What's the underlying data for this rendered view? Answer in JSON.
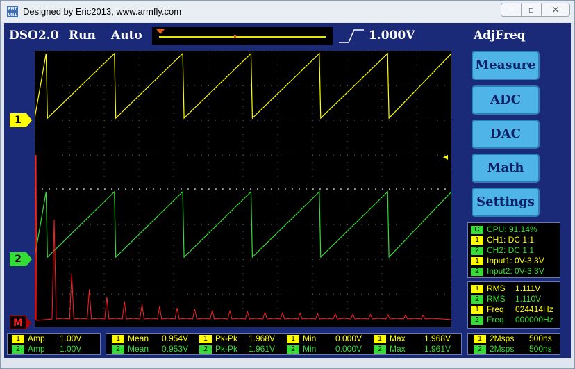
{
  "window": {
    "title": "Designed by Eric2013, www.armfly.com",
    "icon_text": "EMI UNI"
  },
  "header": {
    "product": "DSO2.0",
    "run_state": "Run",
    "mode": "Auto",
    "trigger_level": "1.000V",
    "adj": "AdjFreq"
  },
  "channels": {
    "ch1": "1",
    "ch2": "2",
    "math": "M"
  },
  "side_buttons": [
    "Measure",
    "ADC",
    "DAC",
    "Math",
    "Settings"
  ],
  "status_panel": [
    {
      "tag": "C",
      "text": "CPU: 91.14%",
      "color": "g"
    },
    {
      "tag": "1",
      "text": "CH1: DC 1:1",
      "color": "y"
    },
    {
      "tag": "2",
      "text": "CH2: DC 1:1",
      "color": "g"
    },
    {
      "tag": "1",
      "text": "Input1: 0V-3.3V",
      "color": "y"
    },
    {
      "tag": "2",
      "text": "Input2: 0V-3.3V",
      "color": "g"
    }
  ],
  "rms_panel": [
    {
      "tag": "1",
      "label": "RMS",
      "value": "1.111V",
      "color": "y"
    },
    {
      "tag": "2",
      "label": "RMS",
      "value": "1.110V",
      "color": "g"
    },
    {
      "tag": "1",
      "label": "Freq",
      "value": "024414Hz",
      "color": "y"
    },
    {
      "tag": "2",
      "label": "Freq",
      "value": "000000Hz",
      "color": "g"
    }
  ],
  "amp": [
    {
      "tag": "1",
      "label": "Amp",
      "value": "1.00V"
    },
    {
      "tag": "2",
      "label": "Amp",
      "value": "1.00V"
    }
  ],
  "measurements": {
    "ch1": {
      "mean": "0.954V",
      "pkpk": "1.968V",
      "min": "0.000V",
      "max": "1.968V"
    },
    "ch2": {
      "mean": "0.953V",
      "pkpk": "1.961V",
      "min": "0.000V",
      "max": "1.961V"
    },
    "labels": {
      "mean": "Mean",
      "pkpk": "Pk-Pk",
      "min": "Min",
      "max": "Max"
    }
  },
  "timebase": [
    {
      "tag": "1",
      "rate": "2Msps",
      "div": "500ns"
    },
    {
      "tag": "2",
      "rate": "2Msps",
      "div": "500ns"
    }
  ],
  "colors": {
    "ch1": "#ffff00",
    "ch2": "#33dd33",
    "math": "#ff2020",
    "client_bg": "#1a2a78",
    "button": "#4fb5e8"
  },
  "waveform": {
    "sawtooth_periods_visible": 6.1,
    "fft_peaks": 22
  }
}
